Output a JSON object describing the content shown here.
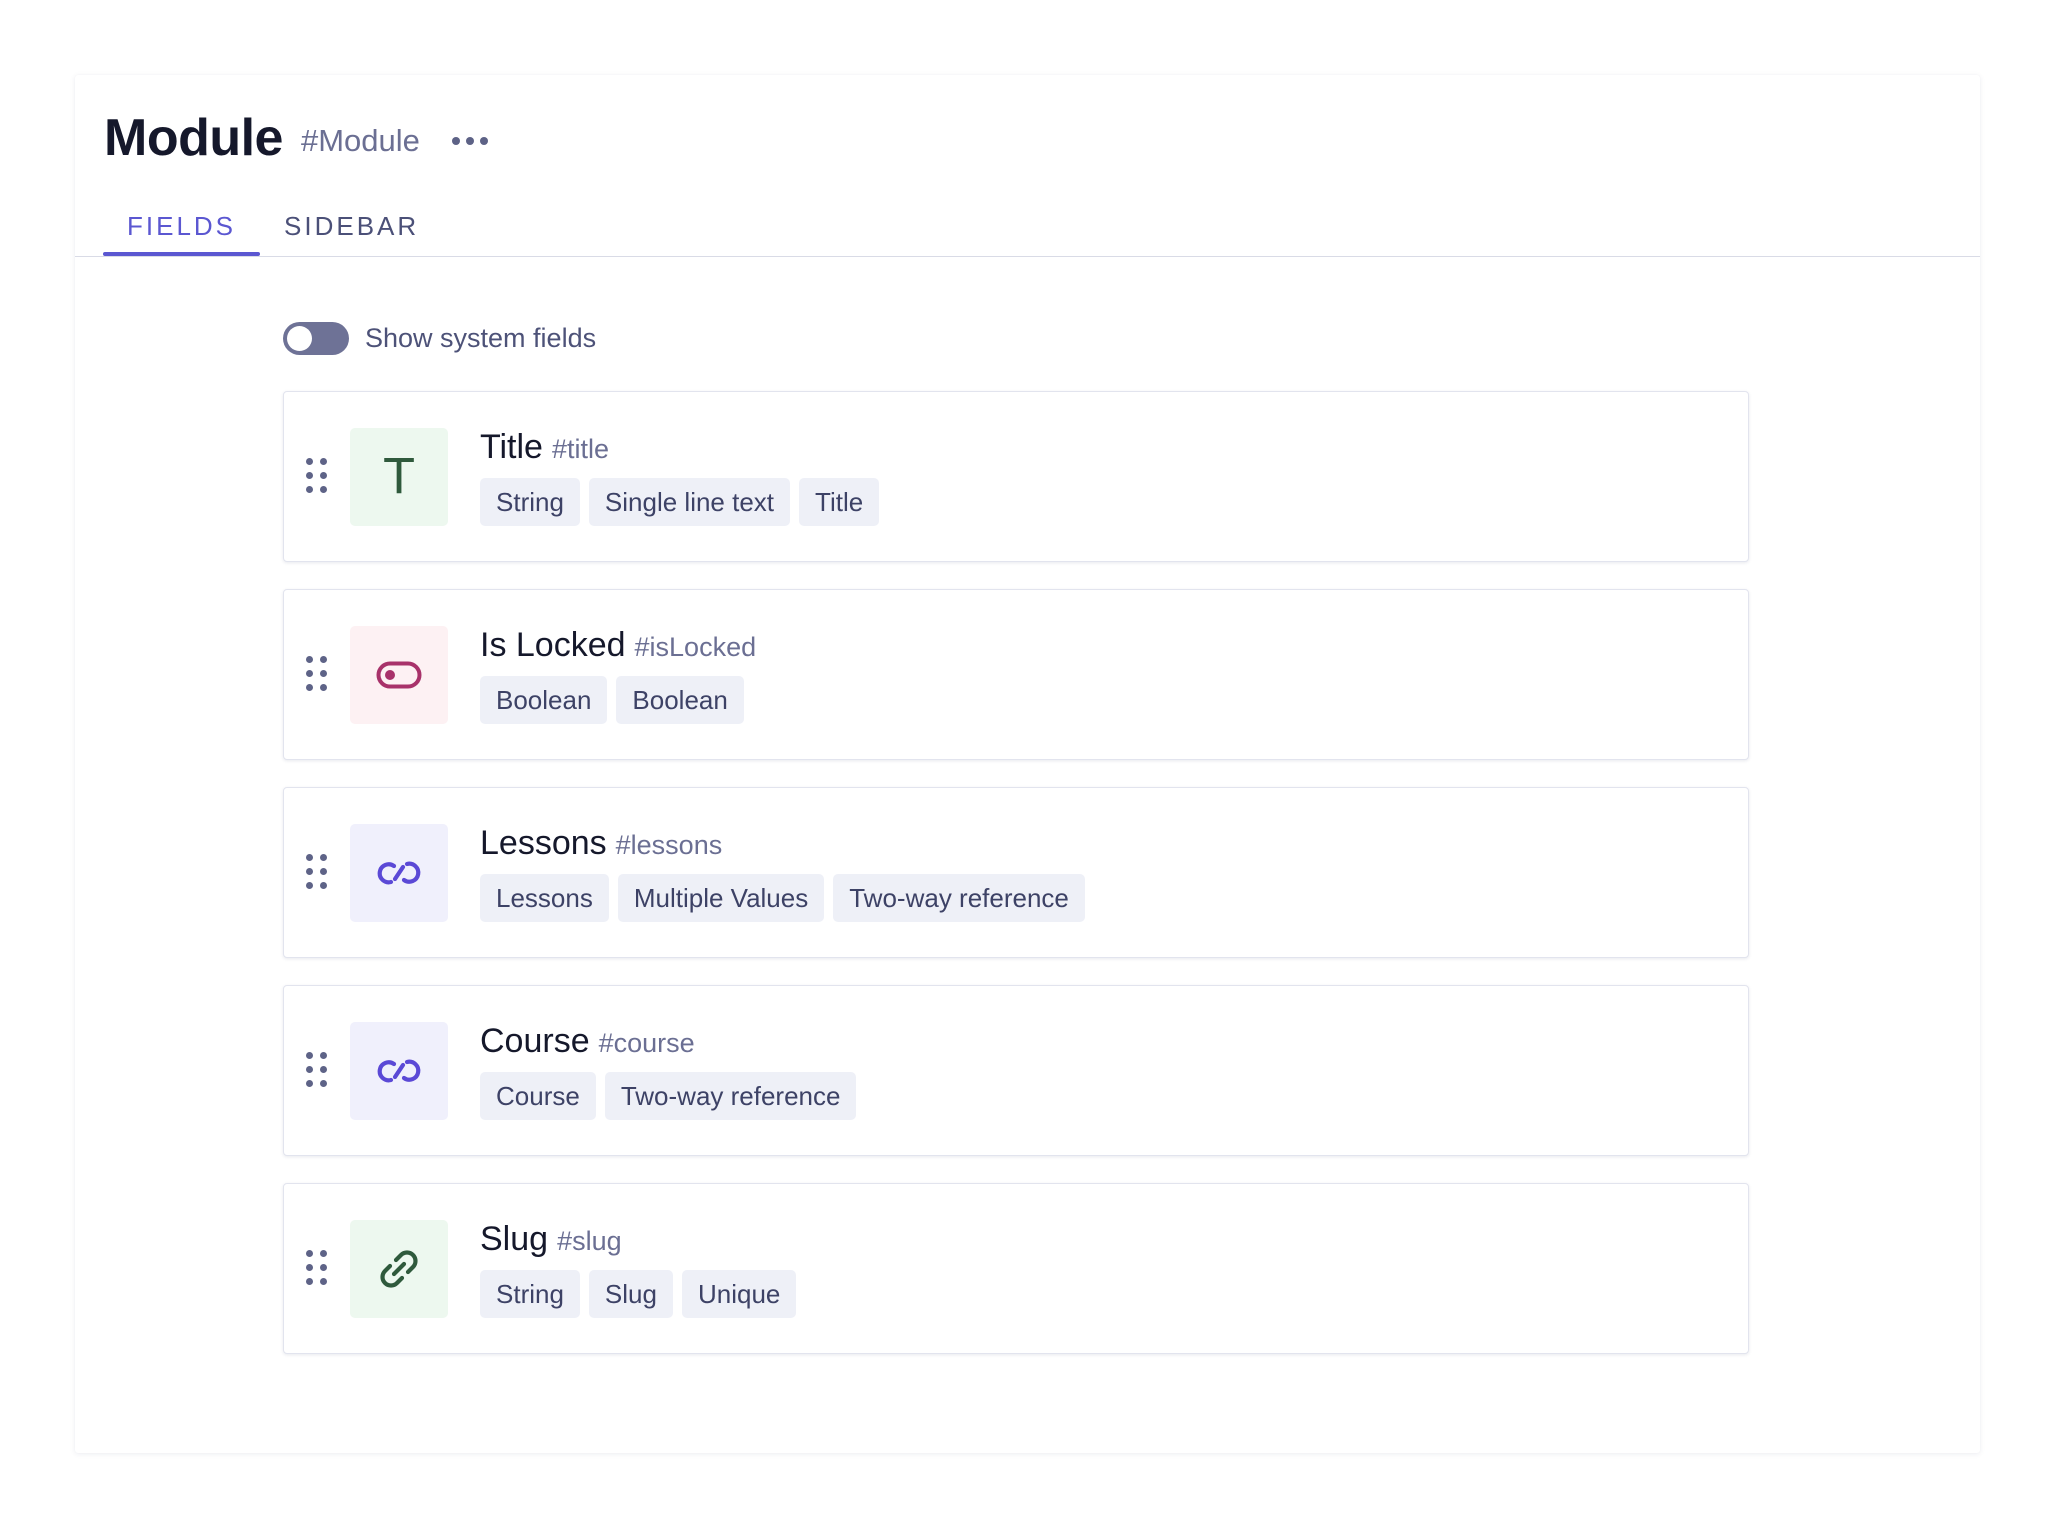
{
  "header": {
    "title": "Module",
    "api_key": "#Module",
    "more_icon": "more-horizontal-icon"
  },
  "tabs": [
    {
      "label": "FIELDS",
      "active": true
    },
    {
      "label": "SIDEBAR",
      "active": false
    }
  ],
  "system_fields_toggle": {
    "label": "Show system fields",
    "on": false
  },
  "colors": {
    "accent": "#5b57d1",
    "text_dark": "#15182b",
    "text_muted": "#6b6f93",
    "tag_bg": "#eef0f7",
    "icon_green_bg": "#edf8ef",
    "icon_pink_bg": "#fdf1f3",
    "icon_purple_bg": "#f0f0fc"
  },
  "fields": [
    {
      "name": "Title",
      "api_key": "#title",
      "icon": "text-t-icon",
      "icon_glyph": "T",
      "tags": [
        "String",
        "Single line text",
        "Title"
      ]
    },
    {
      "name": "Is Locked",
      "api_key": "#isLocked",
      "icon": "toggle-icon",
      "tags": [
        "Boolean",
        "Boolean"
      ]
    },
    {
      "name": "Lessons",
      "api_key": "#lessons",
      "icon": "reference-link-icon",
      "tags": [
        "Lessons",
        "Multiple Values",
        "Two-way reference"
      ]
    },
    {
      "name": "Course",
      "api_key": "#course",
      "icon": "reference-link-icon",
      "tags": [
        "Course",
        "Two-way reference"
      ]
    },
    {
      "name": "Slug",
      "api_key": "#slug",
      "icon": "slug-link-icon",
      "tags": [
        "String",
        "Slug",
        "Unique"
      ]
    }
  ]
}
